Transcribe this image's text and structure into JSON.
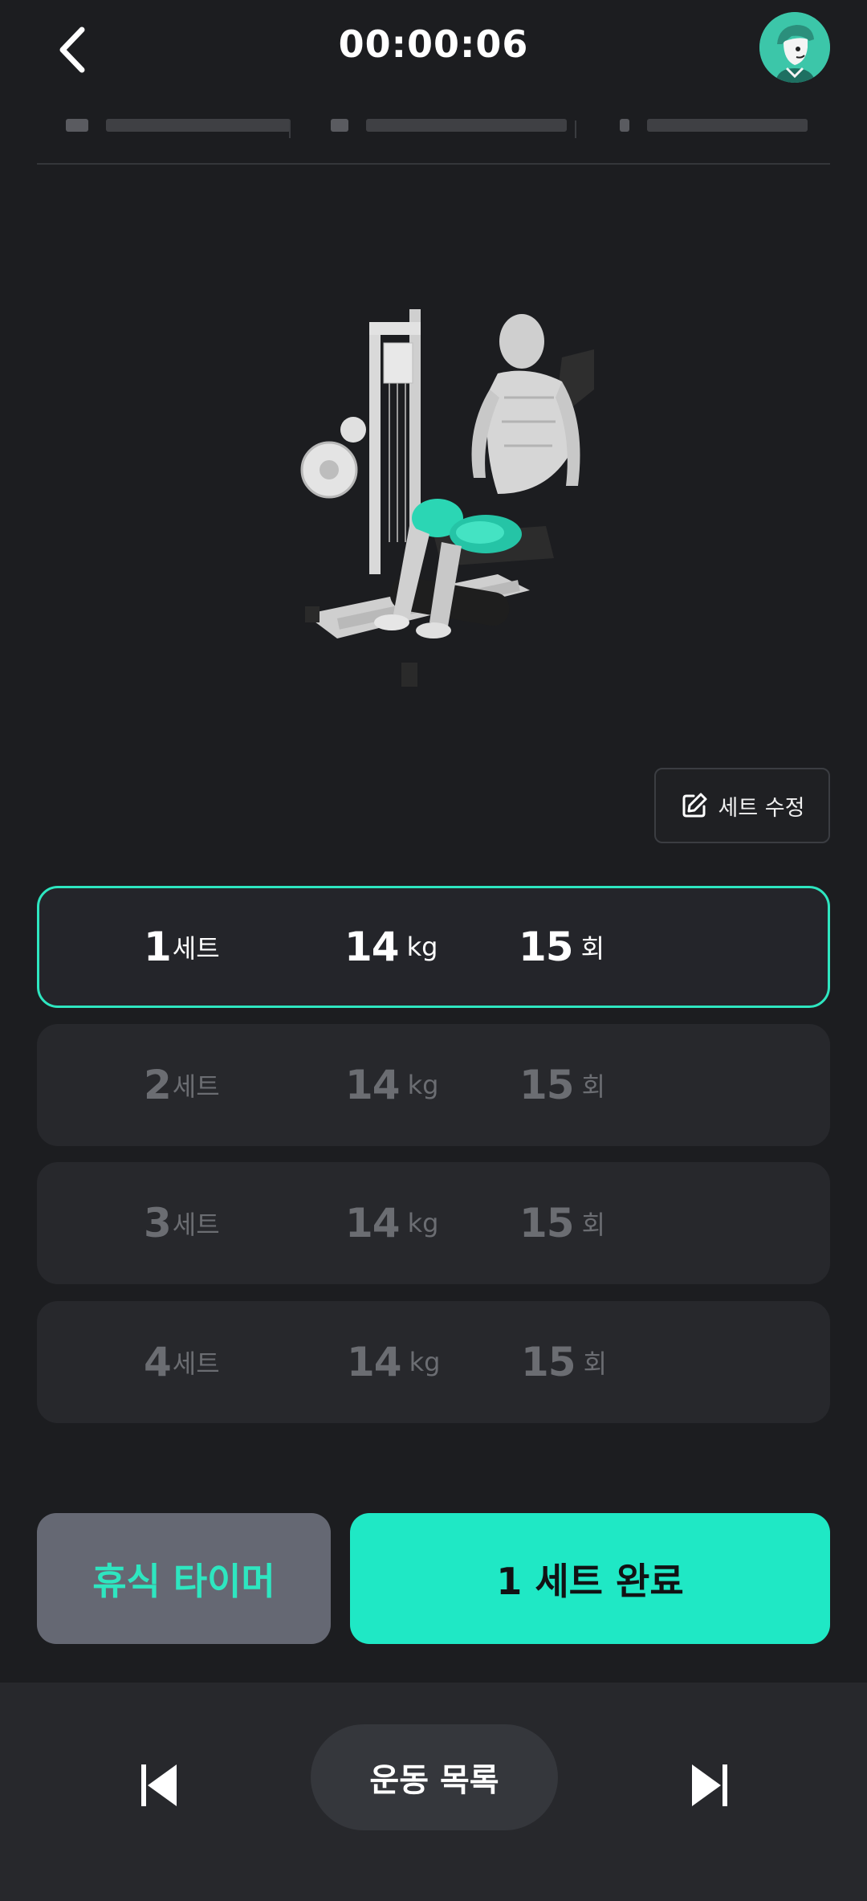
{
  "header": {
    "timer": "00:00:06",
    "back_icon": "chevron-left-icon",
    "avatar_icon": "user-avatar"
  },
  "edit_button": {
    "label": "세트 수정",
    "icon": "edit-icon"
  },
  "sets": [
    {
      "number": "1",
      "set_unit": "세트",
      "weight": "14",
      "weight_unit": "kg",
      "reps": "15",
      "reps_unit": "회",
      "active": true
    },
    {
      "number": "2",
      "set_unit": "세트",
      "weight": "14",
      "weight_unit": "kg",
      "reps": "15",
      "reps_unit": "회",
      "active": false
    },
    {
      "number": "3",
      "set_unit": "세트",
      "weight": "14",
      "weight_unit": "kg",
      "reps": "15",
      "reps_unit": "회",
      "active": false
    },
    {
      "number": "4",
      "set_unit": "세트",
      "weight": "14",
      "weight_unit": "kg",
      "reps": "15",
      "reps_unit": "회",
      "active": false
    }
  ],
  "actions": {
    "rest_timer": "휴식 타이머",
    "complete_set": "1 세트 완료"
  },
  "bottom_nav": {
    "exercise_list": "운동 목록",
    "prev_icon": "skip-previous-icon",
    "next_icon": "skip-next-icon"
  },
  "colors": {
    "accent": "#1fe8c5",
    "background": "#1c1d20",
    "row_inactive": "#27282c",
    "rest_button": "#656873"
  }
}
